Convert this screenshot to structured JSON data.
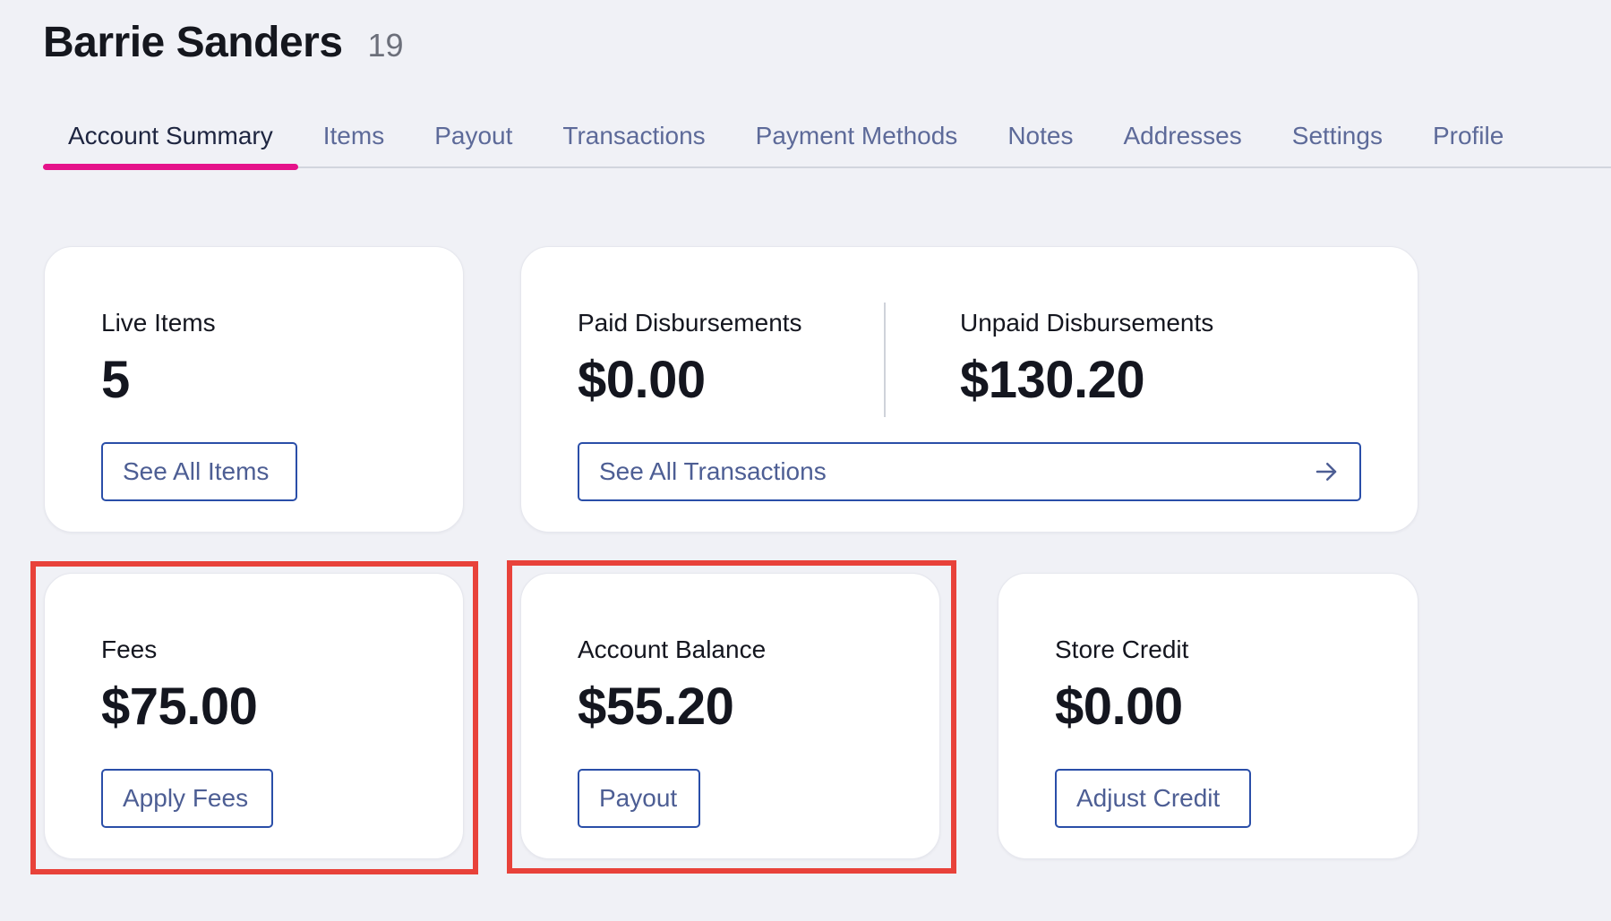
{
  "header": {
    "title": "Barrie Sanders",
    "count": "19"
  },
  "tabs": [
    {
      "label": "Account Summary",
      "active": true
    },
    {
      "label": "Items"
    },
    {
      "label": "Payout"
    },
    {
      "label": "Transactions"
    },
    {
      "label": "Payment Methods"
    },
    {
      "label": "Notes"
    },
    {
      "label": "Addresses"
    },
    {
      "label": "Settings"
    },
    {
      "label": "Profile"
    }
  ],
  "cards": {
    "live_items": {
      "label": "Live Items",
      "value": "5",
      "button": "See All Items"
    },
    "disbursements": {
      "paid_label": "Paid Disbursements",
      "paid_value": "$0.00",
      "unpaid_label": "Unpaid Disbursements",
      "unpaid_value": "$130.20",
      "button": "See All Transactions"
    },
    "fees": {
      "label": "Fees",
      "value": "$75.00",
      "button": "Apply Fees"
    },
    "account_balance": {
      "label": "Account Balance",
      "value": "$55.20",
      "button": "Payout"
    },
    "store_credit": {
      "label": "Store Credit",
      "value": "$0.00",
      "button": "Adjust Credit"
    }
  },
  "colors": {
    "accent": "#e5128a",
    "button_border": "#2a4ea8",
    "highlight": "#e8423a",
    "background": "#f0f1f6"
  },
  "icons": {
    "transactions_arrow": "arrow-right-icon"
  }
}
